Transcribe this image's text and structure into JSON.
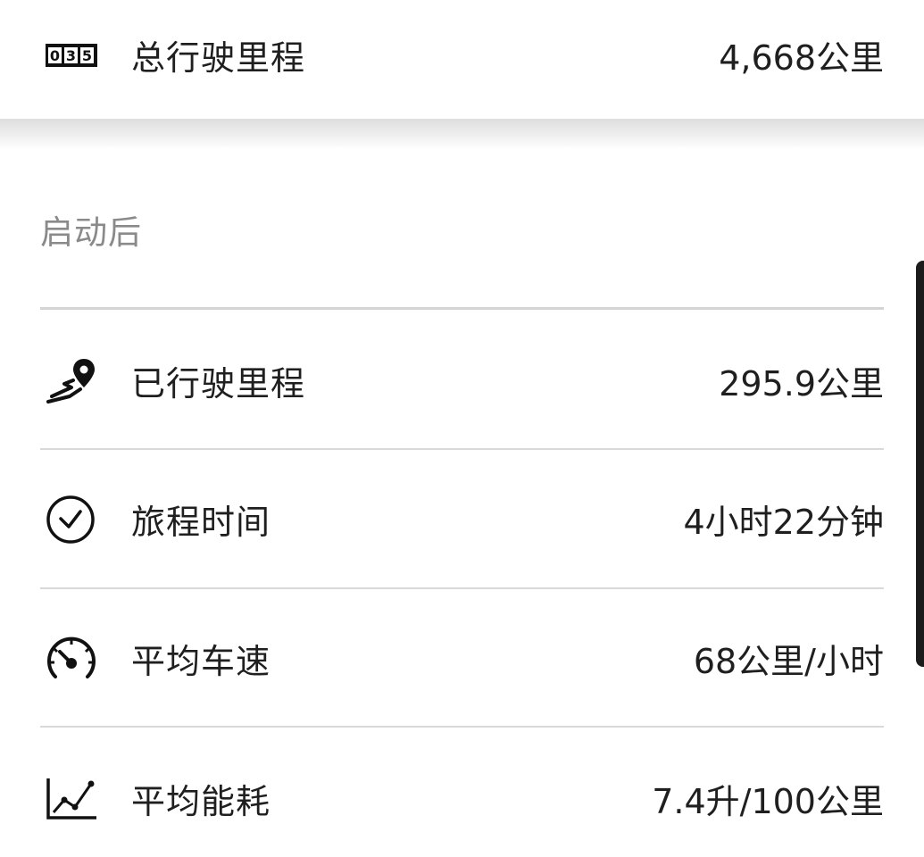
{
  "total": {
    "icon": "odometer-icon",
    "odometer_digits": "035",
    "label": "总行驶里程",
    "value": "4,668公里"
  },
  "section": {
    "title": "启动后"
  },
  "stats": [
    {
      "icon": "route-pin-icon",
      "label": "已行驶里程",
      "value": "295.9公里"
    },
    {
      "icon": "clock-icon",
      "label": "旅程时间",
      "value": "4小时22分钟"
    },
    {
      "icon": "speedometer-icon",
      "label": "平均车速",
      "value": "68公里/小时"
    },
    {
      "icon": "consumption-chart-icon",
      "label": "平均能耗",
      "value": "7.4升/100公里"
    }
  ]
}
